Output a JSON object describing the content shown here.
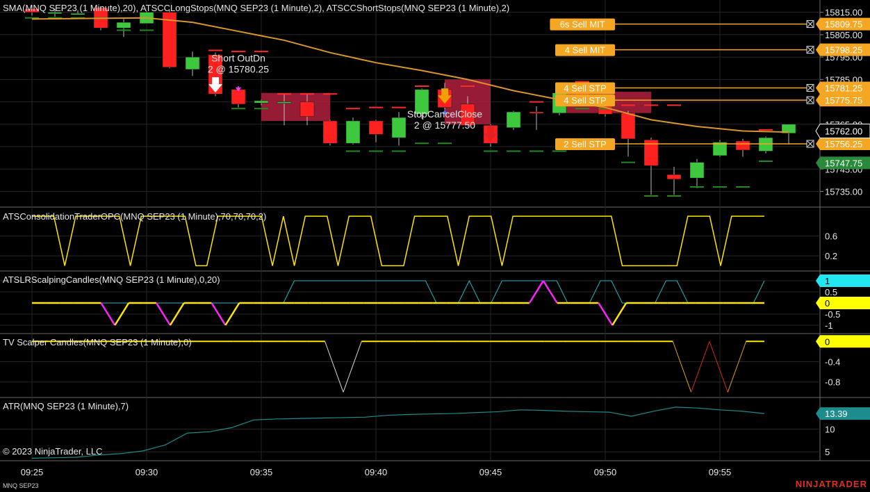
{
  "chart_data": {
    "type": "candlestick",
    "instrument": "MNQ SEP23",
    "x_axis": {
      "ticks": [
        "09:25",
        "09:30",
        "09:35",
        "09:40",
        "09:45",
        "09:50",
        "09:55"
      ]
    },
    "price_panel": {
      "title": "SMA(MNQ SEP23 (1 Minute),20), ATSCCLongStops(MNQ SEP23 (1 Minute),2), ATSCCShortStops(MNQ SEP23 (1 Minute),2)",
      "y_ticks": [
        15815.0,
        15805.0,
        15795.0,
        15785.0,
        15775.0,
        15765.0,
        15755.0,
        15745.0,
        15735.0
      ],
      "ylim": [
        15730.5,
        15818.0
      ],
      "candles": [
        {
          "t": "09:25",
          "o": 15816.5,
          "h": 15818.0,
          "l": 15813.5,
          "c": 15815.0
        },
        {
          "t": "09:26",
          "o": 15814.5,
          "h": 15816.5,
          "l": 15813.0,
          "c": 15815.0
        },
        {
          "t": "09:27",
          "o": 15814.5,
          "h": 15816.0,
          "l": 15814.0,
          "c": 15814.5
        },
        {
          "t": "09:28",
          "o": 15817.0,
          "h": 15817.5,
          "l": 15807.0,
          "c": 15808.0
        },
        {
          "t": "09:29",
          "o": 15808.0,
          "h": 15812.0,
          "l": 15804.0,
          "c": 15810.5
        },
        {
          "t": "09:30",
          "o": 15810.0,
          "h": 15815.5,
          "l": 15810.0,
          "c": 15815.0
        },
        {
          "t": "09:31",
          "o": 15815.0,
          "h": 15816.0,
          "l": 15790.0,
          "c": 15790.5
        },
        {
          "t": "09:32",
          "o": 15789.5,
          "h": 15797.5,
          "l": 15786.5,
          "c": 15795.0
        },
        {
          "t": "09:33",
          "o": 15796.0,
          "h": 15797.0,
          "l": 15777.5,
          "c": 15778.5
        },
        {
          "t": "09:34",
          "o": 15780.5,
          "h": 15782.0,
          "l": 15772.5,
          "c": 15774.0
        },
        {
          "t": "09:35",
          "o": 15774.5,
          "h": 15776.0,
          "l": 15773.5,
          "c": 15775.5
        },
        {
          "t": "09:36",
          "o": 15775.0,
          "h": 15778.5,
          "l": 15764.5,
          "c": 15775.0
        },
        {
          "t": "09:37",
          "o": 15775.0,
          "h": 15778.5,
          "l": 15764.5,
          "c": 15768.5
        },
        {
          "t": "09:38",
          "o": 15766.5,
          "h": 15767.0,
          "l": 15755.5,
          "c": 15756.5
        },
        {
          "t": "09:39",
          "o": 15756.5,
          "h": 15768.0,
          "l": 15756.0,
          "c": 15766.5
        },
        {
          "t": "09:40",
          "o": 15766.5,
          "h": 15767.0,
          "l": 15757.0,
          "c": 15760.5
        },
        {
          "t": "09:41",
          "o": 15759.0,
          "h": 15770.5,
          "l": 15755.5,
          "c": 15768.0
        },
        {
          "t": "09:42",
          "o": 15769.5,
          "h": 15781.0,
          "l": 15767.5,
          "c": 15780.5
        },
        {
          "t": "09:43",
          "o": 15780.5,
          "h": 15783.5,
          "l": 15771.5,
          "c": 15772.5
        },
        {
          "t": "09:44",
          "o": 15774.0,
          "h": 15777.5,
          "l": 15764.0,
          "c": 15764.5
        },
        {
          "t": "09:45",
          "o": 15764.5,
          "h": 15765.0,
          "l": 15755.0,
          "c": 15756.5
        },
        {
          "t": "09:46",
          "o": 15763.5,
          "h": 15771.0,
          "l": 15762.5,
          "c": 15770.5
        },
        {
          "t": "09:47",
          "o": 15770.5,
          "h": 15773.0,
          "l": 15762.5,
          "c": 15770.0
        },
        {
          "t": "09:48",
          "o": 15770.0,
          "h": 15780.5,
          "l": 15769.0,
          "c": 15779.0
        },
        {
          "t": "09:49",
          "o": 15779.0,
          "h": 15781.0,
          "l": 15774.5,
          "c": 15775.0
        },
        {
          "t": "09:50",
          "o": 15775.0,
          "h": 15776.5,
          "l": 15768.5,
          "c": 15769.5
        },
        {
          "t": "09:51",
          "o": 15770.0,
          "h": 15771.0,
          "l": 15750.5,
          "c": 15758.5
        },
        {
          "t": "09:52",
          "o": 15758.0,
          "h": 15759.0,
          "l": 15733.5,
          "c": 15746.5
        },
        {
          "t": "09:53",
          "o": 15742.5,
          "h": 15746.0,
          "l": 15733.5,
          "c": 15740.5
        },
        {
          "t": "09:54",
          "o": 15741.0,
          "h": 15749.5,
          "l": 15736.5,
          "c": 15748.0
        },
        {
          "t": "09:55",
          "o": 15751.0,
          "h": 15758.0,
          "l": 15750.5,
          "c": 15757.0
        },
        {
          "t": "09:56",
          "o": 15757.5,
          "h": 15758.5,
          "l": 15750.5,
          "c": 15753.5
        },
        {
          "t": "09:57",
          "o": 15753.0,
          "h": 15759.5,
          "l": 15752.0,
          "c": 15759.0
        },
        {
          "t": "09:58",
          "o": 15761.0,
          "h": 15765.0,
          "l": 15756.0,
          "c": 15765.0
        }
      ],
      "sma": [
        {
          "t": "09:25",
          "v": 15812.0
        },
        {
          "t": "09:30",
          "v": 15812.5
        },
        {
          "t": "09:32",
          "v": 15810.5
        },
        {
          "t": "09:34",
          "v": 15806.5
        },
        {
          "t": "09:36",
          "v": 15802.5
        },
        {
          "t": "09:38",
          "v": 15797.0
        },
        {
          "t": "09:40",
          "v": 15792.5
        },
        {
          "t": "09:42",
          "v": 15789.0
        },
        {
          "t": "09:44",
          "v": 15785.0
        },
        {
          "t": "09:46",
          "v": 15780.0
        },
        {
          "t": "09:48",
          "v": 15776.0
        },
        {
          "t": "09:50",
          "v": 15772.5
        },
        {
          "t": "09:52",
          "v": 15767.0
        },
        {
          "t": "09:54",
          "v": 15764.0
        },
        {
          "t": "09:56",
          "v": 15762.0
        },
        {
          "t": "09:58",
          "v": 15761.5
        }
      ],
      "short_stops": [
        {
          "t": "09:33",
          "v": 15798.0
        },
        {
          "t": "09:34",
          "v": 15797.5
        },
        {
          "t": "09:35",
          "v": 15797.5
        },
        {
          "t": "09:36",
          "v": 15778.5
        },
        {
          "t": "09:37",
          "v": 15778.5
        },
        {
          "t": "09:38",
          "v": 15778.5
        },
        {
          "t": "09:39",
          "v": 15772.0
        },
        {
          "t": "09:40",
          "v": 15772.5
        },
        {
          "t": "09:41",
          "v": 15772.5
        },
        {
          "t": "09:42",
          "v": 15782.0
        },
        {
          "t": "09:44",
          "v": 15782.0
        },
        {
          "t": "09:47",
          "v": 15775.0
        },
        {
          "t": "09:49",
          "v": 15784.0
        },
        {
          "t": "09:50",
          "v": 15773.5
        },
        {
          "t": "09:51",
          "v": 15773.5
        },
        {
          "t": "09:52",
          "v": 15773.5
        },
        {
          "t": "09:53",
          "v": 15773.5
        },
        {
          "t": "09:57",
          "v": 15762.5
        }
      ],
      "long_stops": [
        {
          "t": "09:25",
          "v": 15812.5
        },
        {
          "t": "09:26",
          "v": 15812.5
        },
        {
          "t": "09:27",
          "v": 15812.5
        },
        {
          "t": "09:28",
          "v": 15812.5
        },
        {
          "t": "09:29",
          "v": 15807.0
        },
        {
          "t": "09:30",
          "v": 15807.0
        },
        {
          "t": "09:34",
          "v": 15772.0
        },
        {
          "t": "09:35",
          "v": 15772.0
        },
        {
          "t": "09:39",
          "v": 15753.0
        },
        {
          "t": "09:40",
          "v": 15753.0
        },
        {
          "t": "09:41",
          "v": 15753.0
        },
        {
          "t": "09:42",
          "v": 15756.5
        },
        {
          "t": "09:43",
          "v": 15756.5
        },
        {
          "t": "09:45",
          "v": 15753.0
        },
        {
          "t": "09:46",
          "v": 15753.0
        },
        {
          "t": "09:47",
          "v": 15753.0
        },
        {
          "t": "09:48",
          "v": 15753.0
        },
        {
          "t": "09:49",
          "v": 15772.0
        },
        {
          "t": "09:50",
          "v": 15772.0
        },
        {
          "t": "09:51",
          "v": 15748.0
        },
        {
          "t": "09:52",
          "v": 15733.0
        },
        {
          "t": "09:53",
          "v": 15733.0
        },
        {
          "t": "09:54",
          "v": 15737.0
        },
        {
          "t": "09:55",
          "v": 15737.0
        },
        {
          "t": "09:56",
          "v": 15737.0
        },
        {
          "t": "09:57",
          "v": 15748.5
        }
      ],
      "zones": [
        {
          "t1": "09:35",
          "t2": "09:38",
          "top": 15779.0,
          "bottom": 15766.5
        },
        {
          "t1": "09:43",
          "t2": "09:45",
          "top": 15785.0,
          "bottom": 15765.0
        },
        {
          "t1": "09:48",
          "t2": "09:52",
          "top": 15779.5,
          "bottom": 15770.0
        }
      ],
      "annotations": [
        {
          "t": "09:34",
          "v": 15793.0,
          "lines": [
            "Short OutDn",
            "2 @ 15780.25"
          ]
        },
        {
          "t": "09:43",
          "v": 15768.0,
          "lines": [
            "StopCancelClose",
            "2 @ 15777.50"
          ]
        }
      ],
      "orders": [
        {
          "label": "6s Sell MIT",
          "price": 15809.75,
          "price_label": "15809.75"
        },
        {
          "label": "4 Sell MIT",
          "price": 15798.25,
          "price_label": "15798.25"
        },
        {
          "label": "4 Sell STP",
          "price": 15781.25,
          "price_label": "15781.25"
        },
        {
          "label": "4 Sell STP",
          "price": 15775.75,
          "price_label": "15775.75"
        },
        {
          "label": "2 Sell STP",
          "price": 15756.25,
          "price_label": "15756.25"
        }
      ],
      "last_price": 15762.0,
      "last_price_label": "15762.00",
      "stop_price": 15747.75,
      "stop_price_label": "15747.75"
    },
    "consolidation_panel": {
      "title": "ATSConsolidationTraderOPC(MNQ SEP23 (1 Minute),70,70,70,2)",
      "y_ticks": [
        0.6,
        0.2
      ],
      "ylim": [
        -0.05,
        1.1
      ],
      "values": [
        1,
        1,
        1,
        0,
        1,
        1,
        1,
        1,
        1,
        0,
        1,
        1,
        1,
        1,
        1,
        0,
        0,
        1,
        1,
        1,
        1,
        1,
        0,
        1,
        0,
        1,
        1,
        1,
        0,
        1,
        1,
        1,
        0,
        0,
        0,
        1,
        1,
        1,
        1,
        0,
        1,
        1,
        1,
        0,
        1,
        1,
        1,
        1,
        1,
        1,
        1,
        1,
        1,
        1,
        0,
        0,
        0,
        0,
        0,
        0,
        1,
        1,
        1,
        0,
        1,
        1,
        1,
        1
      ]
    },
    "scalping_panel": {
      "title": "ATSLRScalpingCandles(MNQ SEP23 (1 Minute),0,20)",
      "y_ticks": [
        1,
        0.5,
        -0.5,
        -1
      ],
      "ylim": [
        -1.25,
        1.25
      ],
      "zero_label": "0",
      "last_label": "1",
      "yellow": [
        0,
        0,
        0,
        0,
        0,
        0,
        -1,
        0,
        0,
        0,
        -1,
        0,
        0,
        0,
        -1,
        0,
        0,
        0,
        0,
        0,
        0,
        0,
        0,
        0,
        0,
        0,
        0,
        0,
        0,
        0,
        0,
        0,
        0,
        0,
        0,
        0,
        0,
        1,
        0,
        0,
        0,
        0,
        -1,
        0,
        0,
        0,
        0,
        0,
        0,
        0,
        0,
        0,
        0,
        0
      ],
      "cyan": [
        0,
        0,
        0,
        0,
        0,
        0,
        0,
        0,
        0,
        0,
        0,
        0,
        0,
        0,
        0,
        0,
        0,
        0,
        0,
        0,
        0,
        0,
        0,
        0,
        1,
        1,
        1,
        1,
        1,
        1,
        1,
        1,
        1,
        1,
        1,
        1,
        1,
        0,
        0,
        0,
        1,
        0,
        0,
        1,
        1,
        1,
        1,
        1,
        1,
        0,
        0,
        0,
        1,
        1,
        0,
        0,
        0,
        0,
        1,
        1,
        0,
        0,
        0,
        0,
        0,
        0,
        0,
        1
      ]
    },
    "tv_panel": {
      "title": "TV Scalper Candles(MNQ SEP23 (1 Minute),0)",
      "y_ticks": [
        -0.4,
        -0.8
      ],
      "ylim": [
        -1.05,
        0.1
      ],
      "zero_label": "0",
      "values": [
        0,
        0,
        0,
        0,
        0,
        0,
        0,
        0,
        0,
        0,
        0,
        0,
        0,
        0,
        0,
        0,
        0,
        -1,
        0,
        0,
        0,
        0,
        0,
        0,
        0,
        0,
        0,
        0,
        0,
        0,
        0,
        0,
        0,
        0,
        0,
        0,
        -1,
        0,
        -1,
        0,
        0
      ]
    },
    "atr_panel": {
      "title": "ATR(MNQ SEP23 (1 Minute),7)",
      "y_ticks": [
        10,
        5
      ],
      "ylim": [
        3.5,
        16.0
      ],
      "last_label": "13.39",
      "values": [
        3.6,
        3.7,
        3.8,
        4.3,
        4.6,
        5.2,
        6.5,
        9.1,
        9.4,
        10.3,
        12.0,
        12.2,
        12.3,
        12.4,
        12.5,
        12.6,
        13.0,
        13.2,
        13.3,
        13.4,
        13.6,
        13.8,
        14.2,
        14.1,
        13.9,
        13.8,
        13.7,
        12.8,
        13.9,
        14.8,
        14.6,
        14.2,
        13.9,
        13.39
      ]
    }
  },
  "footer": {
    "copyright": "© 2023 NinjaTrader, LLC",
    "instrument": "MNQ SEP23",
    "brand": "NINJATRADER"
  }
}
